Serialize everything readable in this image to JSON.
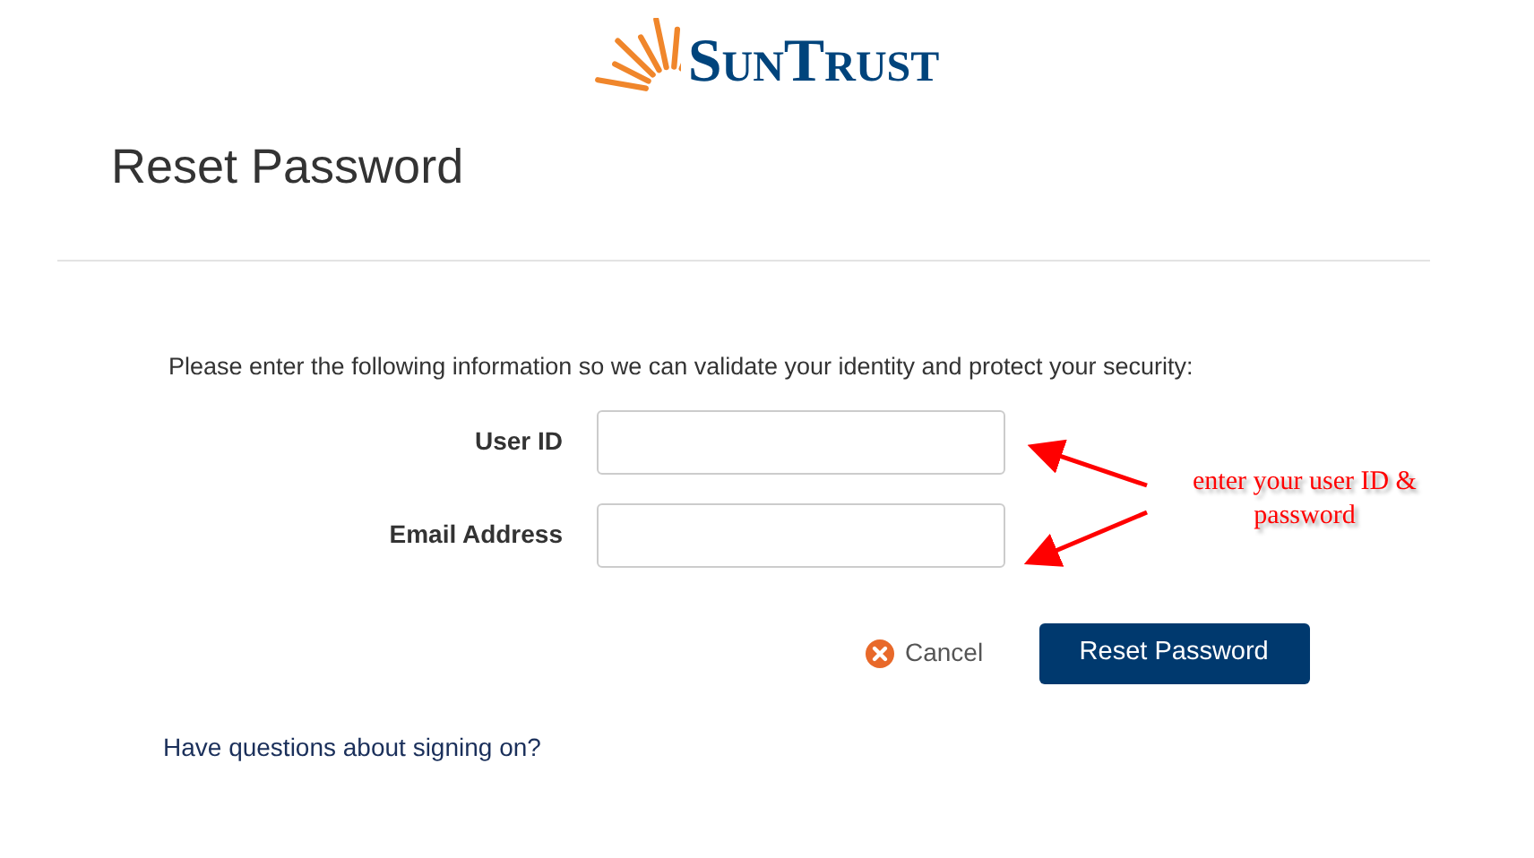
{
  "logo": {
    "text": "SunTrust"
  },
  "title": "Reset Password",
  "instructions": "Please enter the following information so we can validate your identity and protect your security:",
  "fields": [
    {
      "label": "User ID"
    },
    {
      "label": "Email Address"
    }
  ],
  "cancel": "Cancel",
  "submit": "Reset Password",
  "help_link": "Have questions about signing on?",
  "annotation": "enter your user ID & password"
}
